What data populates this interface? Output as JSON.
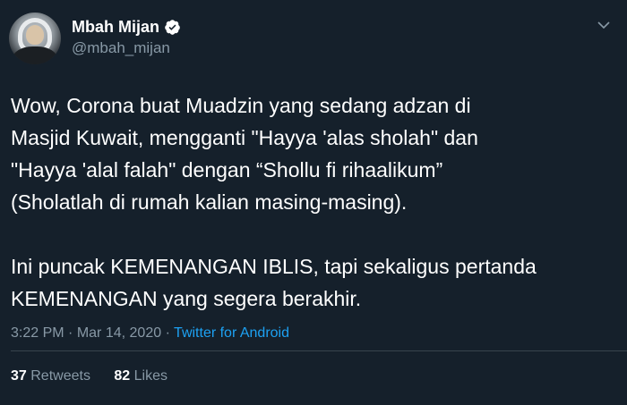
{
  "user": {
    "display_name": "Mbah Mijan",
    "handle": "@mbah_mijan",
    "verified": true
  },
  "tweet": {
    "text": "Wow, Corona buat Muadzin yang sedang adzan di\nMasjid Kuwait, mengganti \"Hayya 'alas sholah\" dan\n\"Hayya 'alal falah\" dengan “Shollu fi rihaalikum”\n(Sholatlah di rumah kalian masing-masing).\n\nIni puncak KEMENANGAN IBLIS, tapi sekaligus pertanda\nKEMENANGAN yang segera berakhir.",
    "time": "3:22 PM",
    "separator1": "·",
    "date": "Mar 14, 2020",
    "separator2": "·",
    "source": "Twitter for Android"
  },
  "stats": {
    "retweets_count": "37",
    "retweets_label": "Retweets",
    "likes_count": "82",
    "likes_label": "Likes"
  },
  "colors": {
    "background": "#15202b",
    "secondary_text": "#8899a6",
    "accent": "#1da1f2",
    "divider": "#38444d"
  },
  "icons": {
    "verified": "verified-badge-icon",
    "menu": "chevron-down-icon"
  }
}
